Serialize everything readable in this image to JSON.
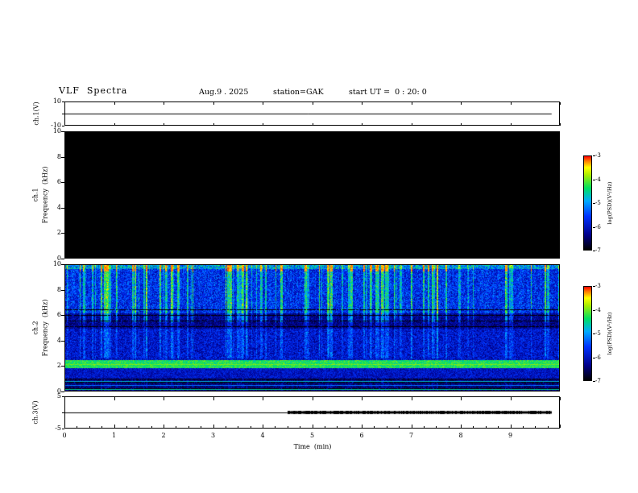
{
  "header": {
    "title": "VLF  Spectra",
    "date": "Aug.9 . 2025",
    "station": "station=GAK",
    "start_ut": "start UT =  0 : 20: 0"
  },
  "xaxis": {
    "label": "Time  (min)",
    "ticks": [
      "0",
      "1",
      "2",
      "3",
      "4",
      "5",
      "6",
      "7",
      "8",
      "9"
    ]
  },
  "panels": {
    "ch1v": {
      "name": "ch.1(V)",
      "ymax": "10",
      "ymin": "-10"
    },
    "ch1spec": {
      "ch_label": "ch.1",
      "axis_label": "Frequency  (kHz)",
      "yticks": [
        "10",
        "8",
        "6",
        "4",
        "2",
        "0"
      ]
    },
    "ch2spec": {
      "ch_label": "ch.2",
      "axis_label": "Frequency  (kHz)",
      "yticks": [
        "10",
        "8",
        "6",
        "4",
        "2",
        "0"
      ]
    },
    "ch3v": {
      "name": "ch.3(V)",
      "ymax": "5",
      "ymin": "-5"
    }
  },
  "colorbar": {
    "label": "log(PSD)(V²/Hz)",
    "ticks": [
      "-3",
      "-4",
      "-5",
      "-6",
      "-7"
    ],
    "stops": [
      {
        "t": 0.0,
        "c": "#000000"
      },
      {
        "t": 0.16,
        "c": "#00008b"
      },
      {
        "t": 0.36,
        "c": "#0033ff"
      },
      {
        "t": 0.52,
        "c": "#00aaff"
      },
      {
        "t": 0.66,
        "c": "#00e060"
      },
      {
        "t": 0.8,
        "c": "#aaee00"
      },
      {
        "t": 0.88,
        "c": "#ffff00"
      },
      {
        "t": 0.95,
        "c": "#ff7700"
      },
      {
        "t": 1.0,
        "c": "#ff0000"
      }
    ]
  },
  "chart_data": [
    {
      "type": "line",
      "title": "ch.1 voltage vs time",
      "ylabel": "ch.1(V)",
      "ylim": [
        -10,
        10
      ],
      "xlim": [
        0,
        10
      ],
      "x": [
        0,
        9.85
      ],
      "values": [
        0,
        0
      ],
      "note": "flat trace at ~0 V across the whole record"
    },
    {
      "type": "heatmap",
      "title": "ch.1 VLF spectrogram",
      "ylabel": "Frequency (kHz)",
      "xlabel": "Time (min)",
      "ylim": [
        0,
        10
      ],
      "xlim": [
        0,
        10
      ],
      "zlabel": "log(PSD)(V²/Hz)",
      "zlim": [
        -7,
        -3
      ],
      "uniform_level": -7,
      "note": "entire panel at colormap floor (-7) -> solid black, no signal on ch.1"
    },
    {
      "type": "heatmap",
      "title": "ch.2 VLF spectrogram",
      "ylabel": "Frequency (kHz)",
      "xlabel": "Time (min)",
      "ylim": [
        0,
        10
      ],
      "xlim": [
        0,
        10
      ],
      "zlabel": "log(PSD)(V²/Hz)",
      "zlim": [
        -7,
        -3
      ],
      "bands": [
        {
          "f_lo": 0.0,
          "f_hi": 1.0,
          "level": -6.5,
          "noise": 0.35,
          "desc": "dark base with thin horizontal lines"
        },
        {
          "f_lo": 1.0,
          "f_hi": 1.8,
          "level": -6.0,
          "noise": 0.4,
          "desc": "blue"
        },
        {
          "f_lo": 1.8,
          "f_hi": 2.5,
          "level": -4.3,
          "noise": 0.35,
          "desc": "strong continuous green band near 2 kHz"
        },
        {
          "f_lo": 2.5,
          "f_hi": 5.0,
          "level": -6.0,
          "noise": 0.5,
          "desc": "blue with cyan speckle"
        },
        {
          "f_lo": 5.0,
          "f_hi": 6.2,
          "level": -6.4,
          "noise": 0.4,
          "desc": "darker band with black horizontal lines"
        },
        {
          "f_lo": 6.2,
          "f_hi": 9.7,
          "level": -5.8,
          "noise": 0.6,
          "desc": "blue/cyan with dense vertical streaks"
        },
        {
          "f_lo": 9.7,
          "f_hi": 10.0,
          "level": -5.1,
          "noise": 0.8,
          "desc": "bright speckled top edge, occasional red"
        }
      ],
      "streaks": {
        "probability": 0.28,
        "boost": 1.9,
        "desc": "dense impulsive vertical streaks reaching green/yellow, strongest above ~5.5 kHz"
      },
      "dark_lines_khz": [
        0.2,
        0.45,
        0.7,
        0.95,
        5.15,
        5.6,
        6.05,
        6.5
      ],
      "bright_lines": [
        {
          "f_khz": 2.1,
          "level": -4.0
        },
        {
          "f_khz": 0.75,
          "level": -4.8
        },
        {
          "f_khz": 0.45,
          "level": -5.2
        },
        {
          "f_khz": 0.1,
          "level": -4.6
        }
      ],
      "note": "continuous signal over full 0-10 min span"
    },
    {
      "type": "line",
      "title": "ch.3 voltage vs time",
      "ylabel": "ch.3(V)",
      "ylim": [
        -5,
        5
      ],
      "xlim": [
        0,
        10
      ],
      "segments": [
        {
          "x": [
            0,
            4.5
          ],
          "value": 0,
          "style": "thin"
        },
        {
          "x": [
            4.5,
            9.85
          ],
          "value": 0,
          "style": "thick dark band (high-frequency oscillation)"
        }
      ]
    }
  ]
}
